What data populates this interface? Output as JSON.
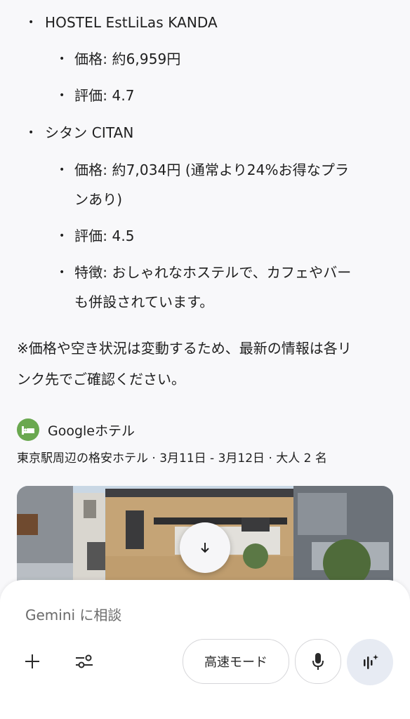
{
  "hostels": [
    {
      "name": "HOSTEL EstLiLas KANDA",
      "price": "価格: 約6,959円",
      "rating": "評価: 4.7"
    },
    {
      "name": "シタン CITAN",
      "price_line1": "価格: 約7,034円 (通常より24%お得なプラ",
      "price_line2": "ンあり)",
      "rating": "評価: 4.5",
      "feature_line1": "特徴: おしゃれなホステルで、カフェやバー",
      "feature_line2": "も併設されています。"
    }
  ],
  "note": {
    "line1": "※価格や空き状況は変動するため、最新の情報は各リ",
    "line2": "ンク先でご確認ください。"
  },
  "google_hotels": {
    "title": "Googleホテル",
    "subtitle": "東京駅周辺の格安ホテル · 3月11日 - 3月12日 · 大人 2 名",
    "logo_color": "#6aa84f"
  },
  "scroll_button": {
    "icon": "arrow-down-icon"
  },
  "composer": {
    "placeholder": "Gemini に相談",
    "mode_label": "高速モード",
    "icons": [
      "add-icon",
      "tools-icon",
      "mic-icon",
      "live-icon"
    ]
  }
}
